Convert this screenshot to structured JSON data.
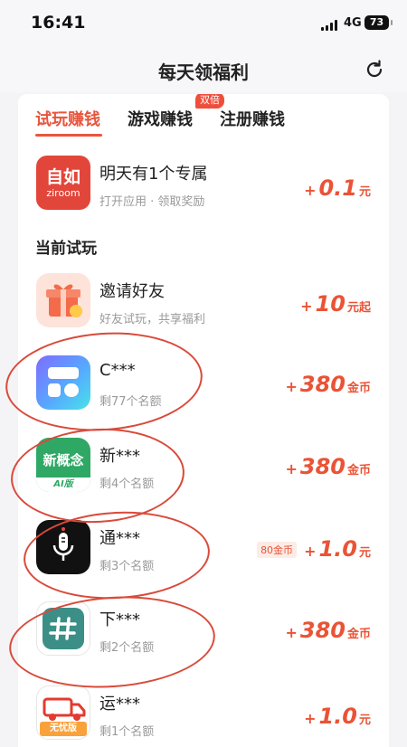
{
  "status_bar": {
    "time": "16:41",
    "network": "4G",
    "battery": "73"
  },
  "header": {
    "title": "每天领福利",
    "refresh_icon": "refresh-icon"
  },
  "tabs": [
    {
      "label": "试玩赚钱",
      "active": true
    },
    {
      "label": "游戏赚钱",
      "active": false,
      "badge": "双倍"
    },
    {
      "label": "注册赚钱",
      "active": false
    }
  ],
  "featured": {
    "name": "明天有1个专属",
    "sub": "打开应用 · 领取奖励",
    "icon": {
      "name": "ziroom-icon",
      "text_top": "自如",
      "text_bottom": "ziroom",
      "color": "#e2463b"
    },
    "reward": {
      "plus": "+",
      "value": "0.1",
      "unit": "元"
    }
  },
  "section_title": "当前试玩",
  "apps": [
    {
      "name": "邀请好友",
      "sub": "好友试玩，共享福利",
      "icon": "gift-icon",
      "reward": {
        "plus": "+",
        "value": "10",
        "unit": "元起"
      }
    },
    {
      "name": "C***",
      "sub": "剩77个名额",
      "icon": "widget-app-icon",
      "reward": {
        "plus": "+",
        "value": "380",
        "unit": "金币"
      }
    },
    {
      "name": "新***",
      "sub": "剩4个名额",
      "icon": "xingainian-icon",
      "icon_text": "新概念",
      "icon_tag": "AI版",
      "reward": {
        "plus": "+",
        "value": "380",
        "unit": "金币"
      }
    },
    {
      "name": "通***",
      "sub": "剩3个名额",
      "icon": "microphone-icon",
      "reward": {
        "tag": "80金币",
        "plus": "+",
        "value": "1.0",
        "unit": "元"
      }
    },
    {
      "name": "下***",
      "sub": "剩2个名额",
      "icon": "hash-icon",
      "reward": {
        "plus": "+",
        "value": "380",
        "unit": "金币"
      }
    },
    {
      "name": "运***",
      "sub": "剩1个名额",
      "icon": "truck-icon",
      "icon_tag": "无忧版",
      "reward": {
        "plus": "+",
        "value": "1.0",
        "unit": "元"
      }
    }
  ],
  "colors": {
    "accent": "#e8553d",
    "reward": "#ea5336",
    "annotation": "#d94a3a"
  }
}
